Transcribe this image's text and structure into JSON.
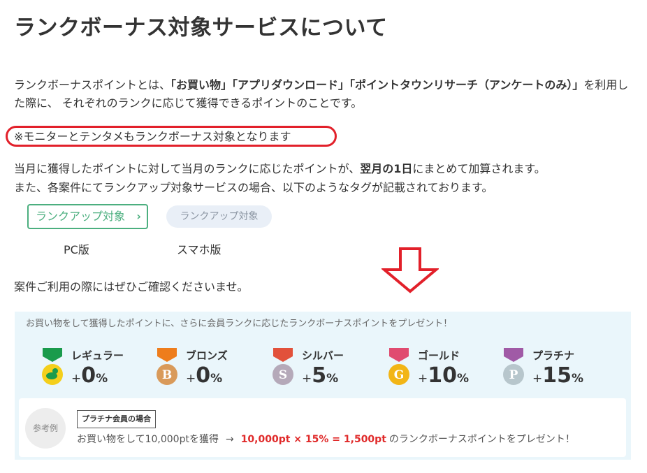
{
  "title": "ランクボーナス対象サービスについて",
  "intro": {
    "pre": "ランクボーナスポイントとは、",
    "bold": "「お買い物」「アプリダウンロード」「ポイントタウンリサーチ（アンケートのみ）」",
    "post": "を利用した際に、 それぞれのランクに応じて獲得できるポイントのことです。"
  },
  "note": "※モニターとテンタメもランクボーナス対象となります",
  "calc_text": {
    "pre": "当月に獲得したポイントに対して当月のランクに応じたポイントが、",
    "bold": "翌月の1日",
    "post": "にまとめて加算されます。"
  },
  "tag_text": "また、各案件にてランクアップ対象サービスの場合、以下のようなタグが記載されております。",
  "tags": {
    "pc_label": "ランクアップ対象",
    "pc_chevron": "›",
    "sp_label": "ランクアップ対象",
    "pc_caption": "PC版",
    "sp_caption": "スマホ版"
  },
  "confirm_text": "案件ご利用の際にはぜひご確認くださいませ。",
  "panel": {
    "header": "お買い物をして獲得したポイントに、さらに会員ランクに応じたランクボーナスポイントをプレゼント！",
    "ranks": [
      {
        "name": "レギュラー",
        "plus": "+",
        "value": "0",
        "unit": "%",
        "ribbon": "#1a9b4c",
        "coin": "#f4cf1c",
        "letter": ""
      },
      {
        "name": "ブロンズ",
        "plus": "+",
        "value": "0",
        "unit": "%",
        "ribbon": "#ee7d1c",
        "coin": "#d99a5a",
        "letter": "B"
      },
      {
        "name": "シルバー",
        "plus": "+",
        "value": "5",
        "unit": "%",
        "ribbon": "#e2513b",
        "coin": "#b5a9b9",
        "letter": "S"
      },
      {
        "name": "ゴールド",
        "plus": "+",
        "value": "10",
        "unit": "%",
        "ribbon": "#e04b70",
        "coin": "#f2b516",
        "letter": "G"
      },
      {
        "name": "プラチナ",
        "plus": "+",
        "value": "15",
        "unit": "%",
        "ribbon": "#a05aa6",
        "coin": "#b7c6cc",
        "letter": "P"
      }
    ],
    "example": {
      "badge": "参考例",
      "tag": "プラチナ会員の場合",
      "line_pre": "お買い物をして10,000ptを獲得",
      "arrow": "→",
      "calc": "10,000pt × 15% = 1,500pt",
      "line_post": "のランクボーナスポイントをプレゼント！"
    }
  }
}
